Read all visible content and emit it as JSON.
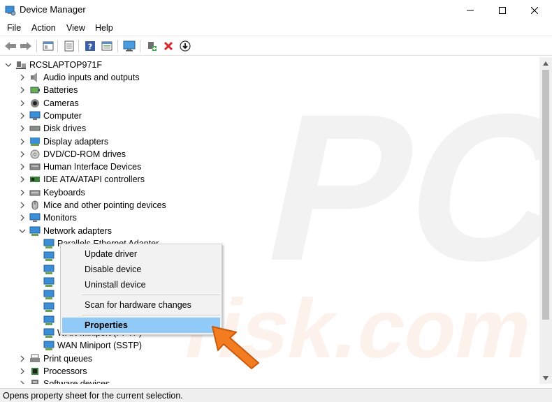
{
  "window": {
    "title": "Device Manager",
    "minimize": "—",
    "maximize": "☐",
    "close": "✕"
  },
  "menu": [
    "File",
    "Action",
    "View",
    "Help"
  ],
  "toolbar": {
    "buttons": [
      "back-icon",
      "forward-icon",
      "show-hide-icon",
      "properties-icon",
      "help-icon",
      "view-icon",
      "monitor-icon",
      "add-driver-icon",
      "uninstall-icon",
      "download-icon"
    ]
  },
  "tree": {
    "root": "RCSLAPTOP971F",
    "categories": [
      {
        "label": "Audio inputs and outputs",
        "icon": "speaker-icon"
      },
      {
        "label": "Batteries",
        "icon": "battery-icon"
      },
      {
        "label": "Cameras",
        "icon": "camera-icon"
      },
      {
        "label": "Computer",
        "icon": "computer-icon"
      },
      {
        "label": "Disk drives",
        "icon": "disk-drive-icon"
      },
      {
        "label": "Display adapters",
        "icon": "display-adapter-icon"
      },
      {
        "label": "DVD/CD-ROM drives",
        "icon": "dvd-drive-icon"
      },
      {
        "label": "Human Interface Devices",
        "icon": "hid-icon"
      },
      {
        "label": "IDE ATA/ATAPI controllers",
        "icon": "ide-controller-icon"
      },
      {
        "label": "Keyboards",
        "icon": "keyboard-icon"
      },
      {
        "label": "Mice and other pointing devices",
        "icon": "mouse-icon"
      },
      {
        "label": "Monitors",
        "icon": "monitor-icon"
      },
      {
        "label": "Network adapters",
        "icon": "network-adapter-icon"
      }
    ],
    "network_children": [
      "Parallels Ethernet Adapter",
      "",
      "",
      "",
      "",
      "",
      "",
      "WAN Miniport (PPTP)",
      "WAN Miniport (SSTP)"
    ],
    "after": [
      {
        "label": "Print queues",
        "icon": "printer-icon"
      },
      {
        "label": "Processors",
        "icon": "processor-icon"
      },
      {
        "label": "Software devices",
        "icon": "software-device-icon"
      }
    ]
  },
  "context_menu": {
    "items": [
      "Update driver",
      "Disable device",
      "Uninstall device",
      "Scan for hardware changes",
      "Properties"
    ],
    "selected": "Properties"
  },
  "status": {
    "text": "Opens property sheet for the current selection."
  },
  "colors": {
    "selection": "#91c9f7",
    "arrow": "#f47c20",
    "watermark": "#d8d8d8"
  }
}
